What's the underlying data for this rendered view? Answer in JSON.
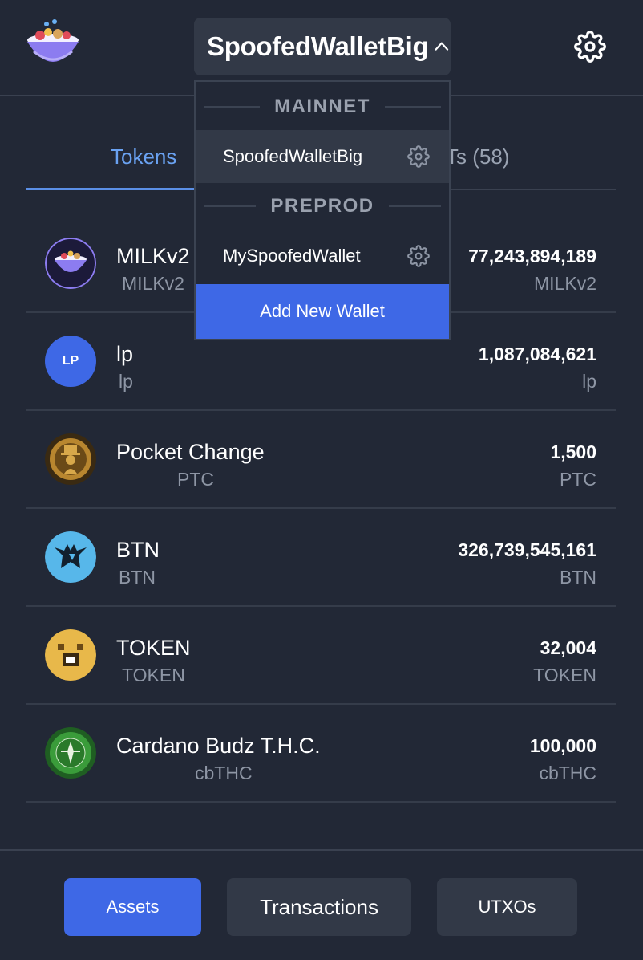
{
  "header": {
    "wallet_name": "SpoofedWalletBig"
  },
  "tabs": {
    "tokens_label": "Tokens",
    "nfts_label_visible": "Ts (58)"
  },
  "dropdown": {
    "mainnet_label": "MAINNET",
    "preprod_label": "PREPROD",
    "mainnet_wallets": [
      "SpoofedWalletBig"
    ],
    "preprod_wallets": [
      "MySpoofedWallet"
    ],
    "add_wallet_label": "Add New Wallet"
  },
  "tokens": [
    {
      "name": "MILKv2",
      "symbol": "MILKv2",
      "amount": "77,243,894,189",
      "amount_symbol": "MILKv2",
      "icon": "cereal-bowl-icon"
    },
    {
      "name": "lp",
      "symbol": "lp",
      "amount": "1,087,084,621",
      "amount_symbol": "lp",
      "icon": "lp-badge-icon",
      "icon_text": "LP"
    },
    {
      "name": "Pocket Change",
      "symbol": "PTC",
      "amount": "1,500",
      "amount_symbol": "PTC",
      "icon": "pocket-change-coin-icon"
    },
    {
      "name": "BTN",
      "symbol": "BTN",
      "amount": "326,739,545,161",
      "amount_symbol": "BTN",
      "icon": "btn-bat-icon"
    },
    {
      "name": "TOKEN",
      "symbol": "TOKEN",
      "amount": "32,004",
      "amount_symbol": "TOKEN",
      "icon": "pixel-face-icon"
    },
    {
      "name": "Cardano Budz T.H.C.",
      "symbol": "cbTHC",
      "amount": "100,000",
      "amount_symbol": "cbTHC",
      "icon": "thc-seal-icon"
    }
  ],
  "bottom_nav": {
    "assets_label": "Assets",
    "transactions_label": "Transactions",
    "utxos_label": "UTXOs"
  },
  "colors": {
    "background": "#222836",
    "accent": "#3e68e6",
    "tab_active": "#6aa2f2",
    "muted_text": "#8e96a5"
  }
}
